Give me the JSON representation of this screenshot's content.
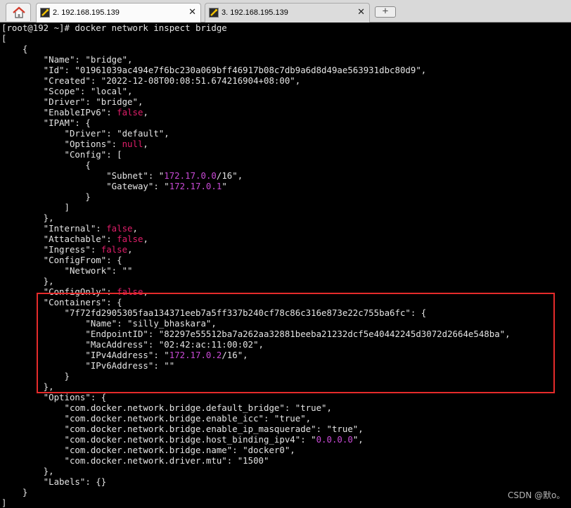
{
  "tabs": [
    {
      "label": "2. 192.168.195.139",
      "close": "✕"
    },
    {
      "label": "3. 192.168.195.139",
      "close": "✕"
    }
  ],
  "new_tab_label": "+",
  "terminal": {
    "prompt": "[root@192 ~]# docker network inspect bridge",
    "lines": [
      "[",
      "    {",
      "        \"Name\": \"bridge\",",
      "        \"Id\": \"01961039ac494e7f6bc230a069bff46917b08c7db9a6d8d49ae563931dbc80d9\",",
      "        \"Created\": \"2022-12-08T00:08:51.674216904+08:00\",",
      "        \"Scope\": \"local\",",
      "        \"Driver\": \"bridge\",",
      "        \"EnableIPv6\": false,",
      "        \"IPAM\": {",
      "            \"Driver\": \"default\",",
      "            \"Options\": null,",
      "            \"Config\": [",
      "                {",
      "                    \"Subnet\": \"172.17.0.0/16\",",
      "                    \"Gateway\": \"172.17.0.1\"",
      "                }",
      "            ]",
      "        },",
      "        \"Internal\": false,",
      "        \"Attachable\": false,",
      "        \"Ingress\": false,",
      "        \"ConfigFrom\": {",
      "            \"Network\": \"\"",
      "        },",
      "        \"ConfigOnly\": false,",
      "        \"Containers\": {",
      "            \"7f72fd2905305faa134371eeb7a5ff337b240cf78c86c316e873e22c755ba6fc\": {",
      "                \"Name\": \"silly_bhaskara\",",
      "                \"EndpointID\": \"82297e55512ba7a262aa32881beeba21232dcf5e40442245d3072d2664e548ba\",",
      "                \"MacAddress\": \"02:42:ac:11:00:02\",",
      "                \"IPv4Address\": \"172.17.0.2/16\",",
      "                \"IPv6Address\": \"\"",
      "            }",
      "        },",
      "        \"Options\": {",
      "            \"com.docker.network.bridge.default_bridge\": \"true\",",
      "            \"com.docker.network.bridge.enable_icc\": \"true\",",
      "            \"com.docker.network.bridge.enable_ip_masquerade\": \"true\",",
      "            \"com.docker.network.bridge.host_binding_ipv4\": \"0.0.0.0\",",
      "            \"com.docker.network.bridge.name\": \"docker0\",",
      "            \"com.docker.network.driver.mtu\": \"1500\"",
      "        },",
      "        \"Labels\": {}",
      "    }",
      "]"
    ]
  },
  "watermark": "CSDN @默o。",
  "colors": {
    "background": "#000000",
    "text": "#e4e4e4",
    "keyword": "#e01e6a",
    "ip": "#c94ad6",
    "highlight_box": "#e52b2b"
  },
  "icons": [
    "home-icon",
    "terminal-tab-icon",
    "close-icon",
    "new-tab-icon"
  ]
}
